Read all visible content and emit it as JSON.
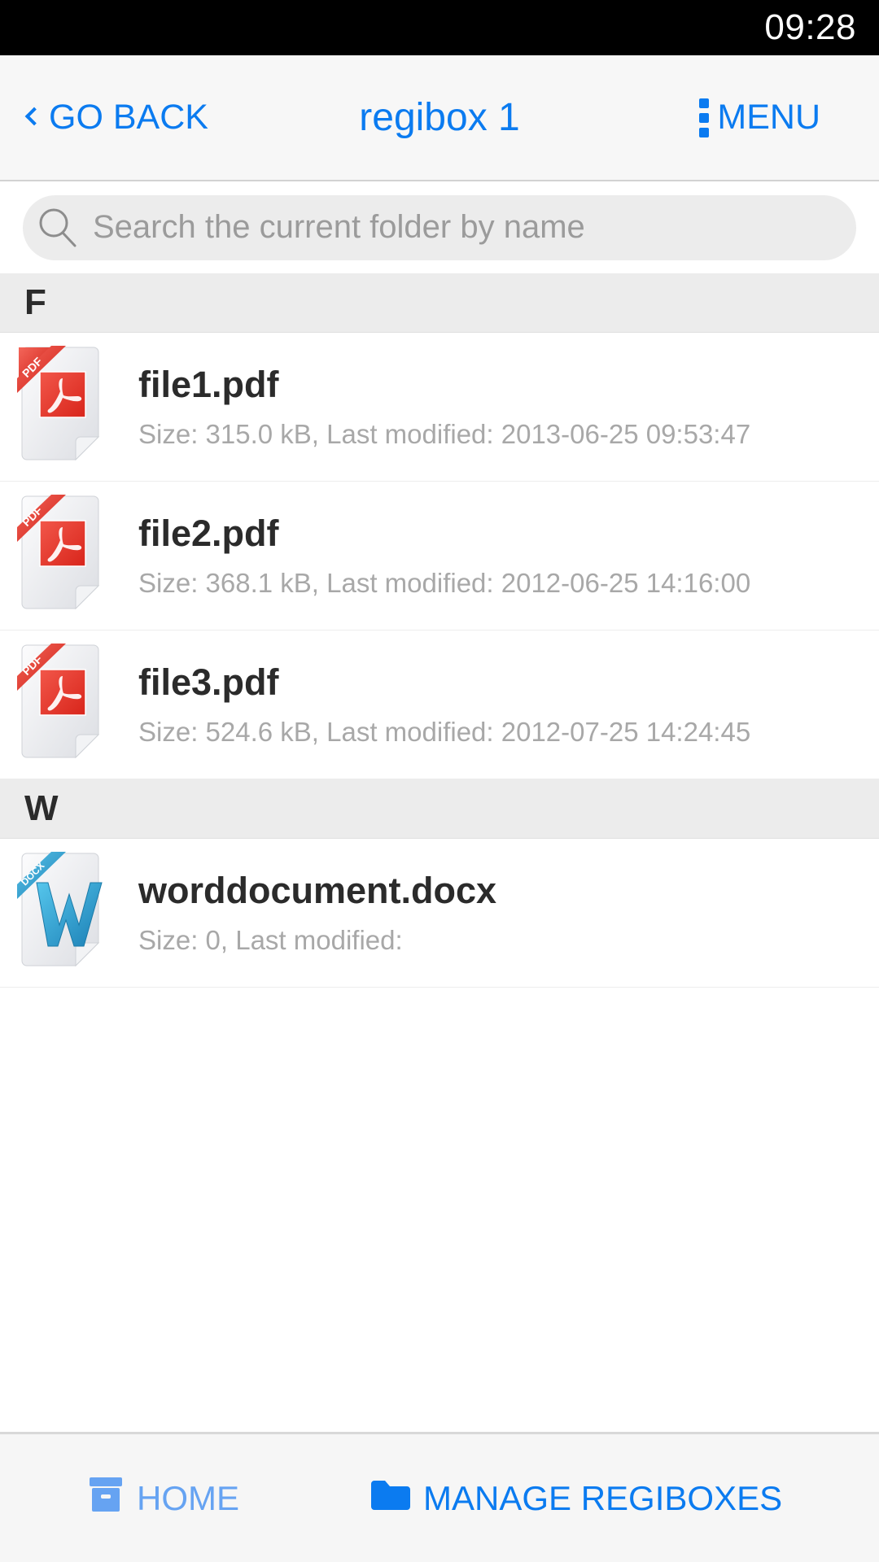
{
  "status_bar": {
    "time": "09:28"
  },
  "header": {
    "back_label": "GO BACK",
    "title": "regibox 1",
    "menu_label": "MENU",
    "accent_color": "#0b7bf0"
  },
  "search": {
    "placeholder": "Search the current folder by name",
    "value": "",
    "icon": "search-icon"
  },
  "file_list": {
    "sections": [
      {
        "letter": "F",
        "files": [
          {
            "name": "file1.pdf",
            "meta": "Size: 315.0 kB, Last modified: 2013-06-25 09:53:47",
            "size": "315.0 kB",
            "last_modified": "2013-06-25 09:53:47",
            "type": "pdf",
            "ribbon": "PDF",
            "icon": "pdf-file-icon"
          },
          {
            "name": "file2.pdf",
            "meta": "Size: 368.1 kB, Last modified: 2012-06-25 14:16:00",
            "size": "368.1 kB",
            "last_modified": "2012-06-25 14:16:00",
            "type": "pdf",
            "ribbon": "PDF",
            "icon": "pdf-file-icon"
          },
          {
            "name": "file3.pdf",
            "meta": "Size: 524.6 kB, Last modified: 2012-07-25 14:24:45",
            "size": "524.6 kB",
            "last_modified": "2012-07-25 14:24:45",
            "type": "pdf",
            "ribbon": "PDF",
            "icon": "pdf-file-icon"
          }
        ]
      },
      {
        "letter": "W",
        "files": [
          {
            "name": "worddocument.docx",
            "meta": "Size: 0, Last modified:",
            "size": "0",
            "last_modified": "",
            "type": "docx",
            "ribbon": "DOCX",
            "icon": "docx-file-icon"
          }
        ]
      }
    ]
  },
  "bottom_nav": {
    "home_label": "HOME",
    "home_icon": "archive-box-icon",
    "home_color": "#66a3f2",
    "manage_label": "MANAGE REGIBOXES",
    "manage_icon": "folder-icon",
    "manage_color": "#0b7bf0"
  },
  "colors": {
    "accent": "#0b7bf0",
    "pdf_red": "#e8362a",
    "docx_blue": "#2b9fd4",
    "section_bg": "#ececec",
    "meta_text": "#a8a8a8"
  }
}
